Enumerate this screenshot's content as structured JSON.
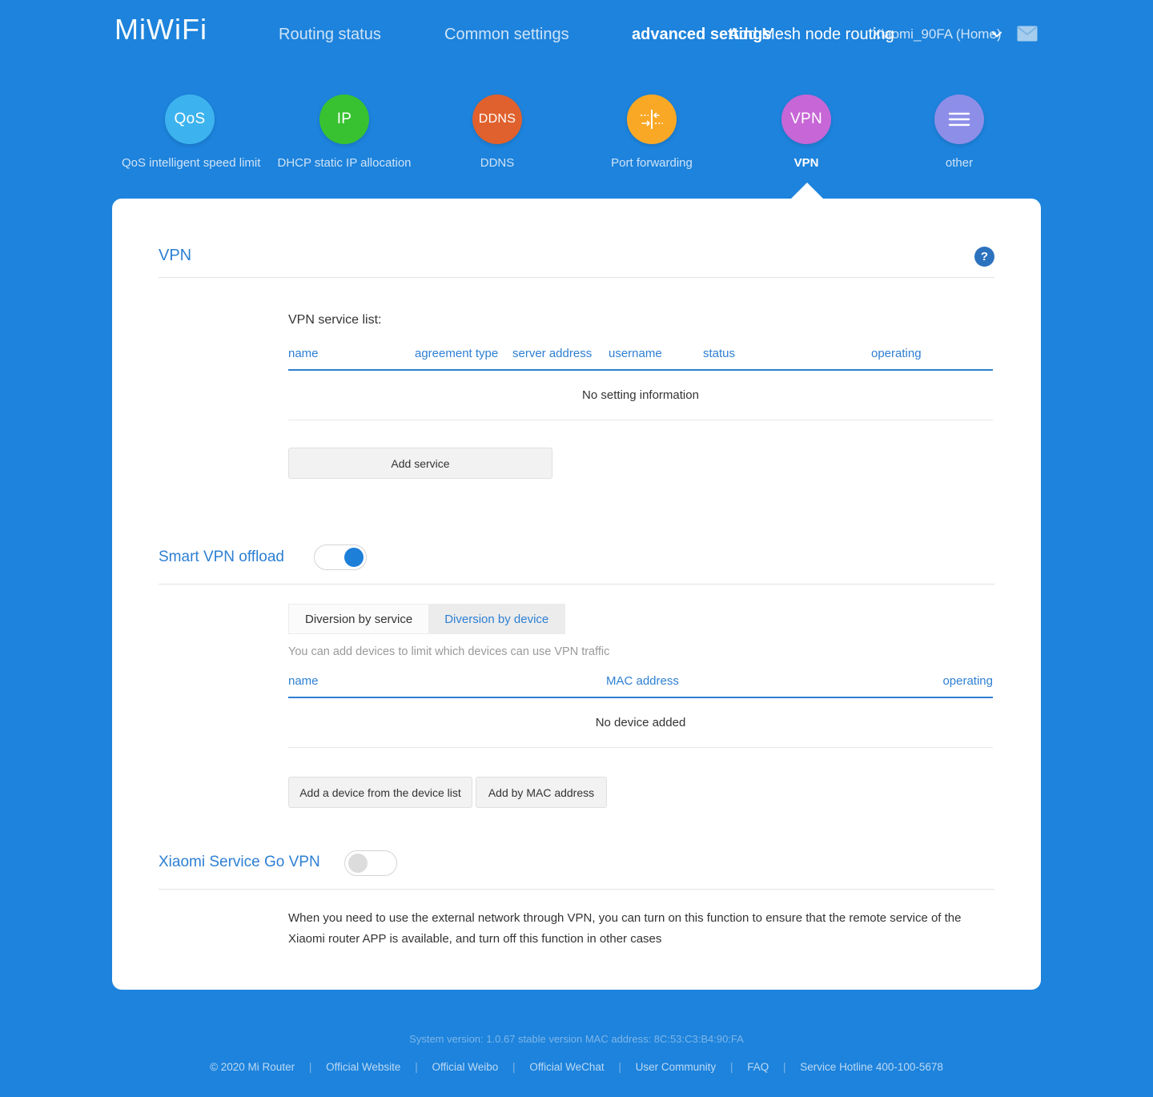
{
  "brand": "MiWiFi",
  "header": {
    "nav": [
      {
        "label": "Routing status",
        "active": false
      },
      {
        "label": "Common settings",
        "active": false
      },
      {
        "label": "advanced settings",
        "active": true
      },
      {
        "label": "Add Mesh node routing",
        "active": false
      }
    ],
    "router_name": "Xiaomi_90FA (Home)",
    "caret_icon": "chevron-down-icon",
    "mail_icon": "mail-icon"
  },
  "feature_icons": [
    {
      "badge": "QoS",
      "label": "QoS intelligent speed limit",
      "color": "#3cb3ef",
      "active": false
    },
    {
      "badge": "IP",
      "label": "DHCP static IP allocation",
      "color": "#38c231",
      "active": false
    },
    {
      "badge": "DDNS",
      "label": "DDNS",
      "color": "#e0612d",
      "active": false
    },
    {
      "badge": "",
      "label": "Port forwarding",
      "color": "#f9a826",
      "active": false,
      "glyph": "port-forwarding-icon"
    },
    {
      "badge": "VPN",
      "label": "VPN",
      "color": "#c766d6",
      "active": true
    },
    {
      "badge": "",
      "label": "other",
      "color": "#8d8ee8",
      "active": false,
      "glyph": "hamburger-icon"
    }
  ],
  "card": {
    "title": "VPN",
    "help_icon": "question-mark-icon",
    "help_label": "?",
    "service_list": {
      "label": "VPN service list:",
      "columns": [
        "name",
        "agreement type",
        "server address",
        "username",
        "status",
        "operating"
      ],
      "empty_text": "No setting information",
      "add_button": "Add service"
    },
    "smart_offload": {
      "title": "Smart VPN offload",
      "toggle_state": "on",
      "tabs": [
        {
          "label": "Diversion by service",
          "active": true
        },
        {
          "label": "Diversion by device",
          "active": false
        }
      ],
      "hint": "You can add devices to limit which devices can use VPN traffic",
      "device_table": {
        "columns": [
          "name",
          "MAC address",
          "operating"
        ],
        "empty_text": "No device added"
      },
      "buttons": [
        "Add a device from the device list",
        "Add by MAC address"
      ]
    },
    "service_go": {
      "title": "Xiaomi Service Go VPN",
      "toggle_state": "off",
      "description": "When you need to use the external network through VPN, you can turn on this function to ensure that the remote service of the Xiaomi router APP is available, and turn off this function in other cases"
    }
  },
  "footer": {
    "system_version": "System version: 1.0.67 stable version MAC address: 8C:53:C3:B4:90:FA",
    "copyright": "© 2020 Mi Router",
    "links": [
      "Official Website",
      "Official Weibo",
      "Official WeChat",
      "User Community",
      "FAQ",
      "Service Hotline 400-100-5678"
    ]
  },
  "colors": {
    "background": "#1d83dc",
    "accent": "#2d7fd3",
    "card": "#ffffff"
  }
}
